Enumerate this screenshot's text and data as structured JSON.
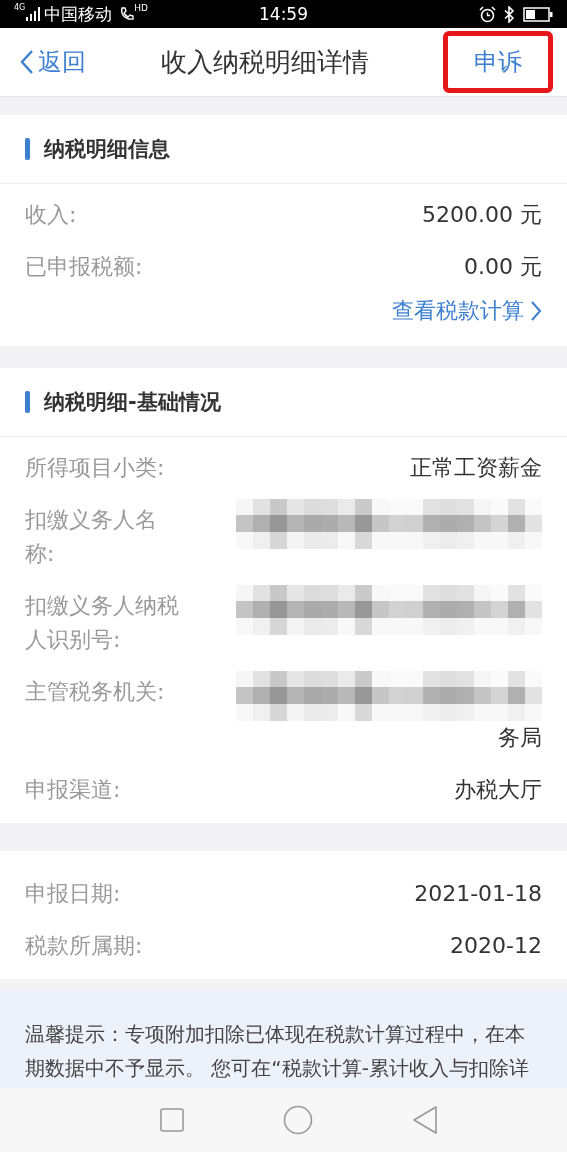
{
  "status_bar": {
    "network": "4G",
    "carrier": "中国移动",
    "call_badge": "HD",
    "time": "14:59"
  },
  "header": {
    "back": "返回",
    "title": "收入纳税明细详情",
    "action": "申诉",
    "action_highlighted": true
  },
  "sections": [
    {
      "title": "纳税明细信息",
      "rows": [
        {
          "label": "收入:",
          "value": "5200.00 元"
        },
        {
          "label": "已申报税额:",
          "value": "0.00 元"
        }
      ],
      "link": "查看税款计算"
    },
    {
      "title": "纳税明细-基础情况",
      "rows": [
        {
          "label": "所得项目小类:",
          "value": "正常工资薪金"
        },
        {
          "label": "扣缴义务人名称:",
          "redacted": true
        },
        {
          "label": "扣缴义务人纳税人识别号:",
          "redacted": true
        },
        {
          "label": "主管税务机关:",
          "redacted": true,
          "value": "务局"
        },
        {
          "label": "申报渠道:",
          "value": "办税大厅"
        }
      ]
    },
    {
      "rows": [
        {
          "label": "申报日期:",
          "value": "2021-01-18"
        },
        {
          "label": "税款所属期:",
          "value": "2020-12"
        }
      ]
    }
  ],
  "notice": "温馨提示：专项附加扣除已体现在税款计算过程中，在本期数据中不予显示。 您可在“税款计算-累计收入与扣除详"
}
